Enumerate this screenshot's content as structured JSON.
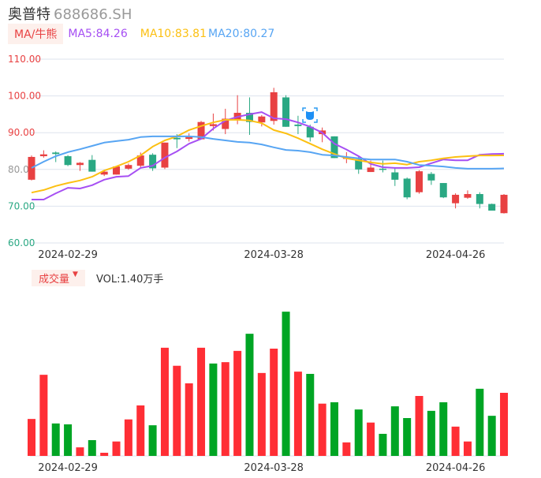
{
  "header": {
    "name": "奥普特",
    "code": "688686.SH"
  },
  "legend": {
    "tag": "MA/牛熊",
    "ma5": "MA5:84.26",
    "ma10": "MA10:83.81",
    "ma20": "MA20:80.27"
  },
  "volume_legend": {
    "tag": "成交量",
    "arrow": "▼",
    "value": "VOL:1.40万手"
  },
  "colors": {
    "up": "#e84142",
    "down": "#2aa883",
    "vol_up": "#ff2e35",
    "vol_down": "#00a524",
    "ma5": "#a64ff3",
    "ma10": "#fcc012",
    "ma20": "#57a5f3",
    "grid": "#dde3ee"
  },
  "icon": "bear-badge-icon",
  "chart_data": [
    {
      "type": "candlestick",
      "ylim": [
        60,
        110
      ],
      "yticks": [
        "110.00",
        "100.00",
        "90.00",
        "80.00",
        "70.00",
        "60.00"
      ],
      "xticks": [
        {
          "index": 3,
          "label": "2024-02-29"
        },
        {
          "index": 20,
          "label": "2024-03-28"
        },
        {
          "index": 35,
          "label": "2024-04-26"
        }
      ],
      "grid": true,
      "ohlc": [
        [
          77.2,
          83.8,
          77.0,
          83.4
        ],
        [
          83.6,
          85.2,
          83.2,
          84.1
        ],
        [
          84.6,
          84.9,
          82.0,
          84.2
        ],
        [
          83.6,
          83.9,
          80.9,
          81.2
        ],
        [
          81.2,
          82.0,
          79.6,
          81.8
        ],
        [
          82.6,
          83.9,
          79.4,
          79.4
        ],
        [
          78.6,
          79.8,
          78.2,
          79.4
        ],
        [
          78.6,
          80.8,
          78.6,
          80.8
        ],
        [
          80.2,
          81.6,
          79.9,
          81.2
        ],
        [
          81.0,
          84.6,
          80.6,
          83.8
        ],
        [
          84.0,
          84.4,
          79.6,
          80.3
        ],
        [
          80.5,
          87.3,
          80.1,
          87.3
        ],
        [
          88.6,
          89.6,
          85.8,
          88.2
        ],
        [
          88.3,
          89.8,
          87.6,
          88.8
        ],
        [
          88.2,
          93.2,
          88.2,
          92.9
        ],
        [
          91.8,
          95.2,
          90.6,
          92.3
        ],
        [
          91.0,
          96.5,
          89.6,
          93.8
        ],
        [
          93.5,
          100.2,
          92.3,
          95.4
        ],
        [
          95.4,
          99.6,
          89.4,
          92.9
        ],
        [
          92.8,
          94.8,
          91.7,
          94.4
        ],
        [
          93.2,
          102.2,
          92.2,
          101.0
        ],
        [
          99.6,
          100.2,
          91.6,
          91.6
        ],
        [
          92.2,
          94.6,
          89.6,
          91.8
        ],
        [
          91.6,
          92.2,
          87.6,
          88.7
        ],
        [
          89.6,
          91.4,
          87.4,
          90.6
        ],
        [
          89.0,
          89.0,
          83.1,
          83.1
        ],
        [
          83.0,
          84.7,
          81.7,
          83.2
        ],
        [
          82.8,
          83.4,
          78.8,
          80.0
        ],
        [
          79.3,
          82.4,
          79.3,
          80.5
        ],
        [
          80.2,
          82.4,
          79.2,
          80.0
        ],
        [
          79.2,
          80.3,
          75.5,
          77.2
        ],
        [
          77.5,
          77.8,
          71.9,
          72.4
        ],
        [
          73.8,
          79.8,
          73.4,
          79.5
        ],
        [
          78.8,
          79.3,
          75.8,
          77.0
        ],
        [
          76.3,
          76.3,
          72.2,
          72.4
        ],
        [
          70.8,
          73.5,
          69.4,
          73.1
        ],
        [
          72.3,
          74.3,
          72.0,
          73.3
        ],
        [
          73.3,
          73.8,
          69.4,
          70.6
        ],
        [
          70.6,
          70.7,
          68.8,
          68.8
        ],
        [
          68.1,
          73.3,
          68.0,
          73.1
        ]
      ],
      "series": [
        {
          "name": "MA5",
          "values": [
            71.8,
            71.8,
            73.5,
            75.0,
            74.8,
            75.7,
            77.2,
            78.0,
            78.2,
            80.4,
            81.0,
            83.2,
            84.9,
            87.0,
            88.3,
            91.1,
            93.3,
            94.3,
            95.0,
            95.6,
            93.9,
            93.7,
            92.8,
            91.6,
            90.0,
            87.0,
            85.4,
            83.6,
            81.5,
            80.6,
            80.4,
            80.4,
            80.6,
            81.7,
            82.7,
            82.5,
            82.5,
            84.0,
            84.2,
            84.26
          ]
        },
        {
          "name": "MA10",
          "values": [
            73.7,
            74.4,
            75.5,
            76.3,
            77.0,
            78.0,
            79.7,
            80.8,
            82.1,
            83.8,
            86.2,
            87.9,
            89.0,
            90.7,
            91.8,
            92.8,
            93.5,
            93.5,
            93.3,
            92.6,
            90.7,
            89.8,
            88.5,
            87.0,
            85.5,
            84.2,
            83.0,
            82.5,
            81.9,
            81.5,
            81.7,
            81.3,
            82.1,
            82.5,
            83.0,
            83.4,
            83.6,
            83.8,
            83.8,
            83.81
          ]
        },
        {
          "name": "MA20",
          "values": [
            80.4,
            82.1,
            83.6,
            84.7,
            85.5,
            86.4,
            87.3,
            87.7,
            88.1,
            88.8,
            89.0,
            89.0,
            89.0,
            89.0,
            88.8,
            88.3,
            87.9,
            87.5,
            87.3,
            86.8,
            86.0,
            85.3,
            85.1,
            84.7,
            84.0,
            83.8,
            83.4,
            83.0,
            82.7,
            82.7,
            82.7,
            82.1,
            81.2,
            81.0,
            80.8,
            80.4,
            80.2,
            80.2,
            80.2,
            80.27
          ]
        }
      ]
    },
    {
      "type": "bar",
      "unit": "万手",
      "xticks": [
        {
          "index": 3,
          "label": "2024-02-29"
        },
        {
          "index": 20,
          "label": "2024-03-28"
        },
        {
          "index": 35,
          "label": "2024-04-26"
        }
      ],
      "values": [
        0.82,
        1.8,
        0.72,
        0.7,
        0.19,
        0.35,
        0.07,
        0.32,
        0.81,
        1.12,
        0.68,
        2.4,
        2.0,
        1.61,
        2.4,
        2.05,
        2.08,
        2.33,
        2.71,
        1.84,
        2.38,
        3.2,
        1.87,
        1.82,
        1.16,
        1.19,
        0.3,
        1.03,
        0.74,
        0.49,
        1.1,
        0.84,
        1.33,
        1.0,
        1.19,
        0.65,
        0.32,
        1.49,
        0.89,
        1.4
      ],
      "up": [
        1,
        1,
        0,
        0,
        1,
        0,
        1,
        1,
        1,
        1,
        0,
        1,
        1,
        1,
        1,
        0,
        1,
        1,
        0,
        1,
        1,
        0,
        1,
        0,
        1,
        0,
        1,
        0,
        1,
        0,
        0,
        0,
        1,
        0,
        0,
        1,
        1,
        0,
        0,
        1
      ]
    }
  ]
}
